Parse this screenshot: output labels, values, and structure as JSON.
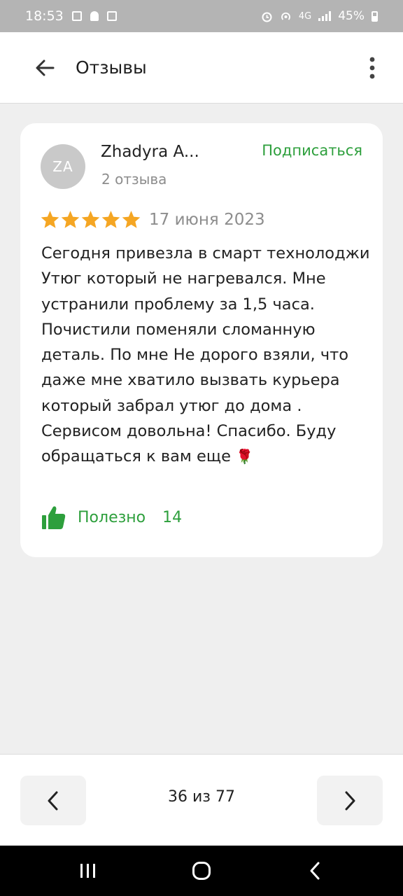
{
  "status_bar": {
    "time": "18:53",
    "network": "4G",
    "battery": "45%"
  },
  "app_bar": {
    "title": "Отзывы",
    "back_icon": "arrow-back-icon",
    "menu_icon": "more-vert-icon"
  },
  "review": {
    "avatar_initials": "ZA",
    "author": "Zhadyra A...",
    "reviews_count": "2 отзыва",
    "subscribe_label": "Подписаться",
    "rating": 5,
    "date": "17 июня 2023",
    "text": "Сегодня привезла в смарт технолоджи Утюг который не нагревался. Мне устранили проблему за 1,5 часа. Почистили поменяли сломанную деталь. По мне Не дорого взяли, что даже мне хватило вызвать курьера который забрал утюг до дома . Сервисом довольна! Спасибо. Буду обращаться к вам еще",
    "emoji": "🌹",
    "useful_label": "Полезно",
    "useful_count": "14"
  },
  "pager": {
    "text": "36 из 77"
  },
  "colors": {
    "accent_green": "#2d9f3c",
    "star": "#f5a623",
    "status_bar": "#b4b4b4"
  }
}
